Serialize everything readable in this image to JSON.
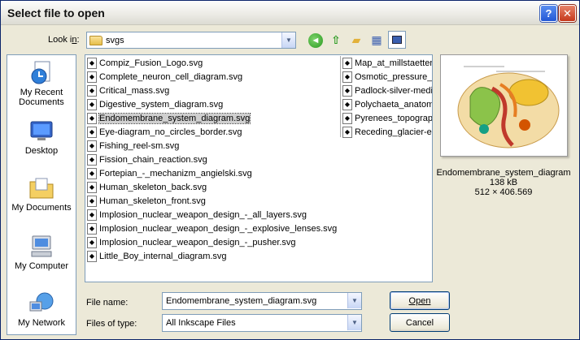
{
  "window": {
    "title": "Select file to open"
  },
  "look_in": {
    "label_pre": "Look i",
    "label_ul": "n",
    "label_post": ":",
    "value": "svgs"
  },
  "places": [
    {
      "label": "My Recent Documents",
      "icon": "recent-documents-icon"
    },
    {
      "label": "Desktop",
      "icon": "desktop-icon"
    },
    {
      "label": "My Documents",
      "icon": "my-documents-icon"
    },
    {
      "label": "My Computer",
      "icon": "my-computer-icon"
    },
    {
      "label": "My Network",
      "icon": "my-network-icon"
    }
  ],
  "files_col1": [
    "Compiz_Fusion_Logo.svg",
    "Complete_neuron_cell_diagram.svg",
    "Critical_mass.svg",
    "Digestive_system_diagram.svg",
    "Endomembrane_system_diagram.svg",
    "Eye-diagram_no_circles_border.svg",
    "Fishing_reel-sm.svg",
    "Fission_chain_reaction.svg",
    "Fortepian_-_mechanizm_angielski.svg",
    "Human_skeleton_back.svg",
    "Human_skeleton_front.svg",
    "Implosion_nuclear_weapon_design_-_all_layers.svg",
    "Implosion_nuclear_weapon_design_-_explosive_lenses.svg",
    "Implosion_nuclear_weapon_design_-_pusher.svg",
    "Little_Boy_internal_diagram.svg"
  ],
  "files_col2": [
    "Map_at_millstaetter",
    "Osmotic_pressure_c",
    "Padlock-silver-mediu",
    "Polychaeta_anatom",
    "Pyrenees_topograp",
    "Receding_glacier-en"
  ],
  "selected_file": "Endomembrane_system_diagram.svg",
  "preview": {
    "name": "Endomembrane_system_diagram",
    "size": "138 kB",
    "dims": "512 × 406.569"
  },
  "file_name": {
    "label": "File name:",
    "value": "Endomembrane_system_diagram.svg"
  },
  "file_type": {
    "label": "Files of type:",
    "value": "All Inkscape Files"
  },
  "buttons": {
    "open": "Open",
    "cancel": "Cancel"
  }
}
